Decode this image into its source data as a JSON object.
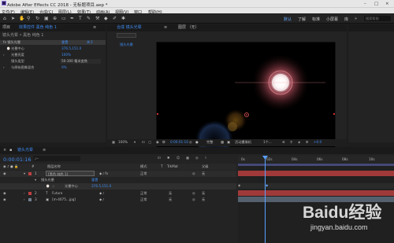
{
  "window": {
    "title": "Adobe After Effects CC 2018 - 无标题项目.aep *",
    "controls": [
      "–",
      "□",
      "×"
    ]
  },
  "menu": [
    "文件(F)",
    "编辑(E)",
    "合成(C)",
    "图层(L)",
    "效果(T)",
    "动画(A)",
    "视图(V)",
    "窗口",
    "帮助(H)"
  ],
  "toolbar": {
    "workspaces": [
      "默认",
      "了解",
      "标准",
      "小屏幕",
      "库"
    ],
    "more": "»",
    "search_placeholder": "搜索帮助"
  },
  "left_panel": {
    "tabs": [
      "项目",
      "效果控件 黑色 纯色 1",
      "≡"
    ],
    "comp_path": "镜头光晕 • 黑色 纯色 1",
    "rows": [
      {
        "label": "fx 镜头光晕",
        "value": "重置",
        "extra": "关于"
      },
      {
        "label": "光晕中心",
        "value": "376.5,151.0"
      },
      {
        "label": "光晕亮度",
        "value": "100%"
      },
      {
        "label": "镜头类型",
        "value": "50-300 毫米变焦"
      },
      {
        "label": "与原始图像混合",
        "value": "0%"
      }
    ]
  },
  "comp_panel": {
    "tabs": [
      "合成 镜头光晕",
      "≡",
      "图层 （无）"
    ],
    "subtab": "镜头光晕",
    "footer": {
      "zoom": "100%",
      "time": "0:00:01:16",
      "resolution": "完整",
      "camera": "活动摄像机",
      "views": "1个...",
      "exposure": "+0.0"
    }
  },
  "timeline": {
    "tab": "镜头光晕",
    "timecode": "0:00:01:16",
    "search_placeholder": "ρ•",
    "columns": [
      "#",
      "图层名称",
      "模式",
      "T",
      "TrkMat",
      "父级"
    ],
    "layers": [
      {
        "index": "1",
        "name": "[黑色 纯色 1]",
        "mode": "正常",
        "trkmat": "",
        "parent": "无",
        "color": "#c04040"
      },
      {
        "index": "",
        "name": "镜头光晕",
        "mode": "重置",
        "trkmat": "",
        "parent": "",
        "color": ""
      },
      {
        "index": "",
        "name": "光晕中心",
        "mode": "376.5,151.0",
        "trkmat": "",
        "parent": "",
        "color": ""
      },
      {
        "index": "2",
        "name": "Future",
        "mode": "正常",
        "trkmat": "无",
        "parent": "无",
        "color": "#c04040"
      },
      {
        "index": "3",
        "name": "[m-4075...jpg]",
        "mode": "正常",
        "trkmat": "无",
        "parent": "无",
        "color": "#708090"
      }
    ],
    "ruler": [
      "0s",
      "02s",
      "04s",
      "06s",
      "08s",
      "10s"
    ]
  },
  "colors": {
    "accent": "#3f8bf0",
    "timecode": "#3f8bf0",
    "layer_red": "#c04040",
    "track_blue": "#4a5a9a",
    "playhead": "#5aa0ff"
  },
  "watermark": {
    "brand": "Baidu经验",
    "url": "jingyan.baidu.com"
  }
}
